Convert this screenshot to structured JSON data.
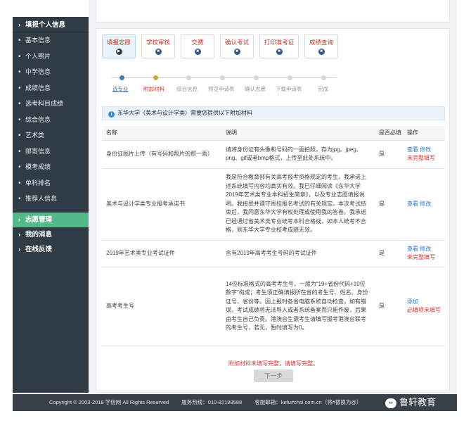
{
  "sidebar": {
    "header": "填报个人信息",
    "items": [
      {
        "label": "基本信息"
      },
      {
        "label": "个人照片"
      },
      {
        "label": "中学信息"
      },
      {
        "label": "成绩信息"
      },
      {
        "label": "选考科目成绩"
      },
      {
        "label": "综合信息"
      },
      {
        "label": "艺术类"
      },
      {
        "label": "邮寄信息"
      },
      {
        "label": "模考成绩"
      },
      {
        "label": "单科排名"
      },
      {
        "label": "推荐人信息"
      }
    ],
    "sections": [
      {
        "label": "志愿管理",
        "active": true
      },
      {
        "label": "我的消息",
        "active": false
      },
      {
        "label": "在线反馈",
        "active": false
      }
    ]
  },
  "tabs": [
    {
      "label": "填报志愿",
      "icon": "play-icon"
    },
    {
      "label": "学校审核",
      "icon": "circle-icon"
    },
    {
      "label": "交费",
      "icon": "circle-icon"
    },
    {
      "label": "确认考试",
      "icon": "circle-icon"
    },
    {
      "label": "打印准考证",
      "icon": "circle-icon"
    },
    {
      "label": "成绩查询",
      "icon": "circle-icon"
    }
  ],
  "steps": [
    "选专业",
    "附加材料",
    "综合信息",
    "预览申请表",
    "确认志愿",
    "下载申请表",
    "完成"
  ],
  "notice": "东华大学（美术与设计学类）需要您提供以下附加材料",
  "table": {
    "headers": [
      "名称",
      "说明",
      "是否必填",
      "操作"
    ],
    "rows": [
      {
        "name": "身份证图片上传（有号码和照片的那一面）",
        "desc": "请将身份证有头像和号码的一面拍照，存为jpg、jpeg、png、gif或者bmp格式，上传至此处系统中。",
        "required": "是",
        "ops": "查看 修改",
        "warn": "未完整填写"
      },
      {
        "name": "美术与设计学类专业报考承诺书",
        "desc": "我是符合教育部有关高考报考资格规定的考生，我承诺上述系统填写内容均真实有效。我已仔细阅读《东华大学2019年艺术类专业本科招生简章》，以及专业志愿填报说明。我接受并遵守贵校报名考试的有关规定。本次考试结束后，我同意东华大学有权处理或使用我的答卷。我承诺已经通过省美术类专业统考本科合格线，如本人统考不合格，则东华大学专业校考成绩无效。",
        "required": "是",
        "ops": "查看 修改",
        "warn": ""
      },
      {
        "name": "2019年艺术类专业考试证件",
        "desc": "含有2019年高考考生号码的考试证件",
        "required": "是",
        "ops": "查看 修改",
        "warn": "未完整填写"
      },
      {
        "name": "高考考生号",
        "desc": "14位标准格式的高考考生号，一般为“19+省份代码+10位数字”构成；考生须正确填报所在省的考生号、姓名、身份证号、省份等。因上报时各省电脑系统自动检查，如有错误，考试成绩将无法导入或者系统备案而只能作废，后果由考生自己负责。港澳台生源考生请填写报考港澳台联考的考生号，若无，暂时填写为0。",
        "required": "是",
        "ops": "添加",
        "warn": "必填项未填写"
      }
    ]
  },
  "submit_warning": "附加材料未填写完整，请填写完整。",
  "next_button": "下一步",
  "footer": {
    "copyright": "Copyright © 2003-2018 学信网 All Rights Reserved",
    "hotline": "服务热线：010-82199588",
    "email": "客服邮箱：kefu#chsi.com.cn（将#替换为@）"
  },
  "watermark": "鲁轩教育"
}
